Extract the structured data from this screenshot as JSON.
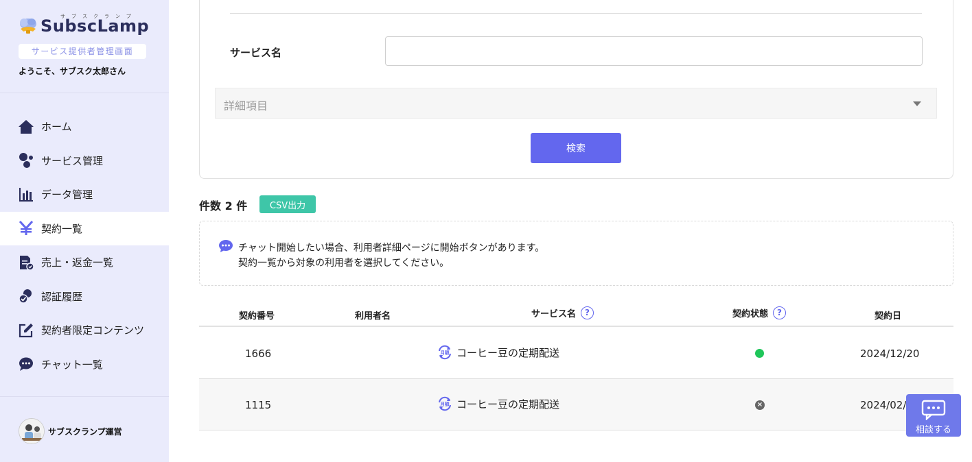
{
  "brand": {
    "logo_text": "SubscLamp",
    "logo_ruby": "サブスクランプ",
    "role_badge": "サービス提供者管理画面",
    "welcome": "ようこそ、サブスク太郎さん"
  },
  "sidebar": {
    "items": [
      {
        "label": "ホーム",
        "icon": "home-icon"
      },
      {
        "label": "サービス管理",
        "icon": "services-icon"
      },
      {
        "label": "データ管理",
        "icon": "bar-chart-icon"
      },
      {
        "label": "契約一覧",
        "icon": "yen-icon"
      },
      {
        "label": "売上・返金一覧",
        "icon": "receipt-icon"
      },
      {
        "label": "認証履歴",
        "icon": "user-check-icon"
      },
      {
        "label": "契約者限定コンテンツ",
        "icon": "edit-icon"
      },
      {
        "label": "チャット一覧",
        "icon": "chat-icon"
      }
    ],
    "account_name": "サブスクランプ運営"
  },
  "search": {
    "service_label": "サービス名",
    "service_value": "",
    "details_label": "詳細項目",
    "search_button": "検索"
  },
  "results": {
    "count_label": "件数 2 件",
    "csv_button": "CSV出力"
  },
  "notice": {
    "line1": "チャット開始したい場合、利用者詳細ページに開始ボタンがあります。",
    "line2": "契約一覧から対象の利用者を選択してください。"
  },
  "table": {
    "headers": {
      "contract_no": "契約番号",
      "user_name": "利用者名",
      "service_name": "サービス名",
      "status": "契約状態",
      "date": "契約日"
    },
    "help_mark": "?",
    "rows": [
      {
        "contract_no": "1666",
        "user_name": "",
        "service_name": "コーヒー豆の定期配送",
        "badge": "月額",
        "status": "active",
        "date": "2024/12/20"
      },
      {
        "contract_no": "1115",
        "user_name": "",
        "service_name": "コーヒー豆の定期配送",
        "badge": "月額",
        "status": "cancelled",
        "date": "2024/02/2"
      }
    ]
  },
  "consult": {
    "label": "相談する"
  },
  "colors": {
    "accent": "#6367ee",
    "sidebar_bg": "#eaebfc",
    "csv_green": "#3ec6a8",
    "status_active": "#1fc65a"
  }
}
